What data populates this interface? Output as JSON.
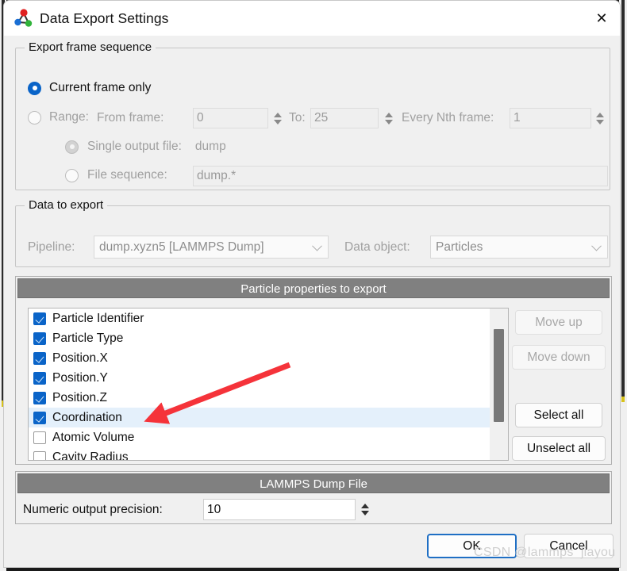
{
  "window": {
    "title": "Data Export Settings",
    "app_icon": "molecule-icon",
    "close_label": "✕"
  },
  "frame_sequence": {
    "legend": "Export frame sequence",
    "current_frame_label": "Current frame only",
    "current_frame_selected": true,
    "range_label": "Range:",
    "range_selected": false,
    "from_frame_label": "From frame:",
    "from_frame_value": "0",
    "to_label": "To:",
    "to_value": "25",
    "every_nth_label": "Every Nth frame:",
    "every_nth_value": "1",
    "single_output_label": "Single output file:",
    "single_output_value": "dump",
    "single_output_selected": true,
    "file_sequence_label": "File sequence:",
    "file_sequence_value": "dump.*",
    "file_sequence_selected": false
  },
  "data_to_export": {
    "legend": "Data to export",
    "pipeline_label": "Pipeline:",
    "pipeline_value": "dump.xyzn5 [LAMMPS Dump]",
    "data_object_label": "Data object:",
    "data_object_value": "Particles"
  },
  "properties_panel": {
    "header": "Particle properties to export",
    "items": [
      {
        "label": "Particle Identifier",
        "checked": true,
        "selected": false
      },
      {
        "label": "Particle Type",
        "checked": true,
        "selected": false
      },
      {
        "label": "Position.X",
        "checked": true,
        "selected": false
      },
      {
        "label": "Position.Y",
        "checked": true,
        "selected": false
      },
      {
        "label": "Position.Z",
        "checked": true,
        "selected": false
      },
      {
        "label": "Coordination",
        "checked": true,
        "selected": true
      },
      {
        "label": "Atomic Volume",
        "checked": false,
        "selected": false
      },
      {
        "label": "Cavity Radius",
        "checked": false,
        "selected": false
      }
    ],
    "buttons": {
      "move_up": "Move up",
      "move_up_enabled": false,
      "move_down": "Move down",
      "move_down_enabled": false,
      "select_all": "Select all",
      "unselect_all": "Unselect all"
    }
  },
  "dump_file": {
    "header": "LAMMPS Dump File",
    "precision_label": "Numeric output precision:",
    "precision_value": "10"
  },
  "footer": {
    "ok_label": "OK",
    "cancel_label": "Cancel"
  },
  "watermark": {
    "text": "CSDN @lammps_jiayou"
  },
  "colors": {
    "accent": "#0a64c8",
    "header_bar": "#808080",
    "selection": "#e4f0fb",
    "arrow": "#f5333a",
    "dialog_bg": "#f0f0f0"
  }
}
